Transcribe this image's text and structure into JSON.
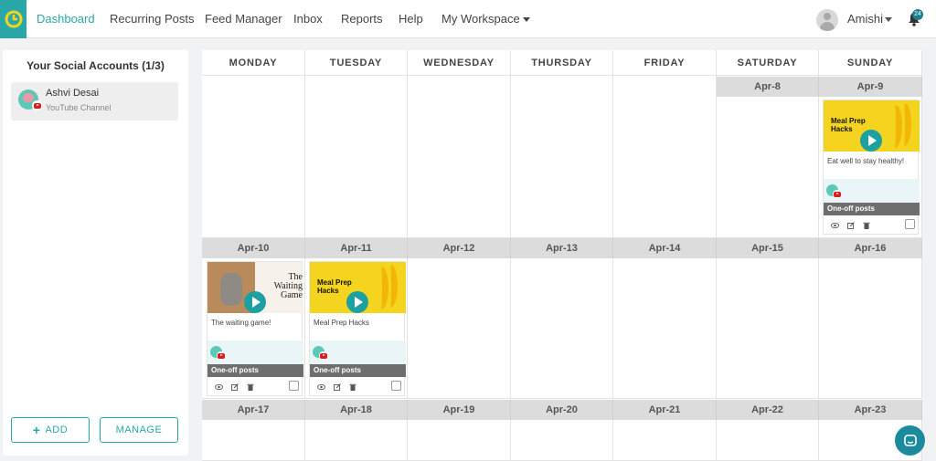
{
  "nav": {
    "items": [
      "Dashboard",
      "Recurring Posts",
      "Feed Manager",
      "Inbox",
      "Reports",
      "Help",
      "My Workspace"
    ],
    "user_name": "Amishi",
    "notification_count": "24",
    "accent": "#2aa7a9"
  },
  "sidebar": {
    "title": "Your Social Accounts (1/3)",
    "account": {
      "name": "Ashvi Desai",
      "type": "YouTube Channel"
    },
    "add_label": "ADD",
    "manage_label": "MANAGE"
  },
  "calendar": {
    "days": [
      "MONDAY",
      "TUESDAY",
      "WEDNESDAY",
      "THURSDAY",
      "FRIDAY",
      "SATURDAY",
      "SUNDAY"
    ],
    "week1_dates": [
      "Apr-8",
      "Apr-9"
    ],
    "week2_dates": [
      "Apr-10",
      "Apr-11",
      "Apr-12",
      "Apr-13",
      "Apr-14",
      "Apr-15",
      "Apr-16"
    ],
    "week3_dates": [
      "Apr-17",
      "Apr-18",
      "Apr-19",
      "Apr-20",
      "Apr-21",
      "Apr-22",
      "Apr-23"
    ]
  },
  "posts": [
    {
      "date": "Apr-9",
      "thumb_title": "Meal Prep Hacks",
      "caption": "Eat well to stay healthy!",
      "type": "One-off posts"
    },
    {
      "date": "Apr-10",
      "thumb_title": "The Waiting Game",
      "caption": "The waiting game!",
      "type": "One-off posts"
    },
    {
      "date": "Apr-11",
      "thumb_title": "Meal Prep Hacks",
      "caption": "Meal Prep Hacks",
      "type": "One-off posts"
    }
  ]
}
